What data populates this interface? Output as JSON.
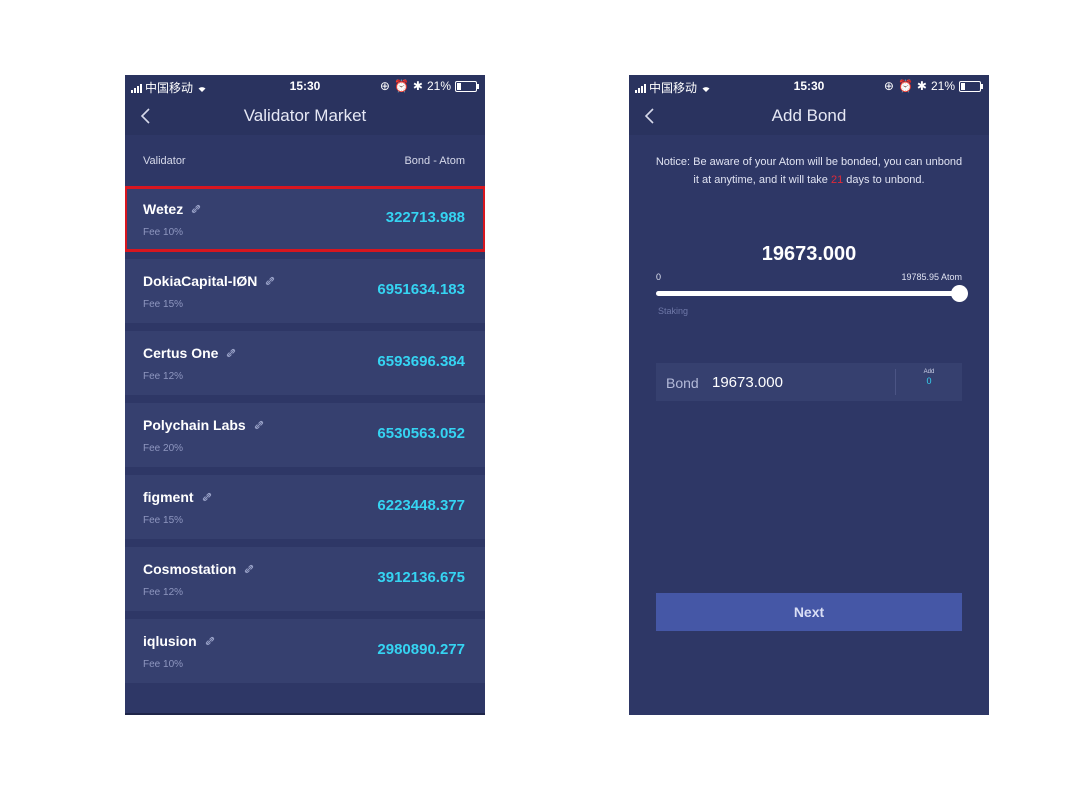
{
  "colors": {
    "phone_bg": "#2e3766",
    "row_bg": "#36406f",
    "accent_cyan": "#35d4f2",
    "highlight_red": "#d8161f",
    "button_bg": "#4557a6",
    "days_red": "#e02a38"
  },
  "status_bar": {
    "carrier": "中国移动",
    "time": "15:30",
    "battery": "21%",
    "battery_level": 0.21
  },
  "left_screen": {
    "title": "Validator Market",
    "header": {
      "validator": "Validator",
      "bond": "Bond - Atom"
    },
    "validators": [
      {
        "name": "Wetez",
        "fee": "Fee 10%",
        "bond": "322713.988",
        "highlighted": true
      },
      {
        "name": "DokiaCapital-IØN",
        "fee": "Fee 15%",
        "bond": "6951634.183",
        "highlighted": false
      },
      {
        "name": "Certus One",
        "fee": "Fee 12%",
        "bond": "6593696.384",
        "highlighted": false
      },
      {
        "name": "Polychain Labs",
        "fee": "Fee 20%",
        "bond": "6530563.052",
        "highlighted": false
      },
      {
        "name": "figment",
        "fee": "Fee 15%",
        "bond": "6223448.377",
        "highlighted": false
      },
      {
        "name": "Cosmostation",
        "fee": "Fee 12%",
        "bond": "3912136.675",
        "highlighted": false
      },
      {
        "name": "iqlusion",
        "fee": "Fee 10%",
        "bond": "2980890.277",
        "highlighted": false
      }
    ]
  },
  "right_screen": {
    "title": "Add Bond",
    "notice_prefix": "Notice: Be aware of your Atom will be bonded, you can unbond it at anytime, and it will take ",
    "notice_days": "21",
    "notice_suffix": " days to unbond.",
    "amount": "19673.000",
    "range_min": "0",
    "range_max": "19785.95 Atom",
    "slider_fraction": 0.994,
    "staking_label": "Staking",
    "bond_label": "Bond",
    "bond_value": "19673.000",
    "add_caption": "Add",
    "add_value": "0",
    "next_label": "Next"
  }
}
